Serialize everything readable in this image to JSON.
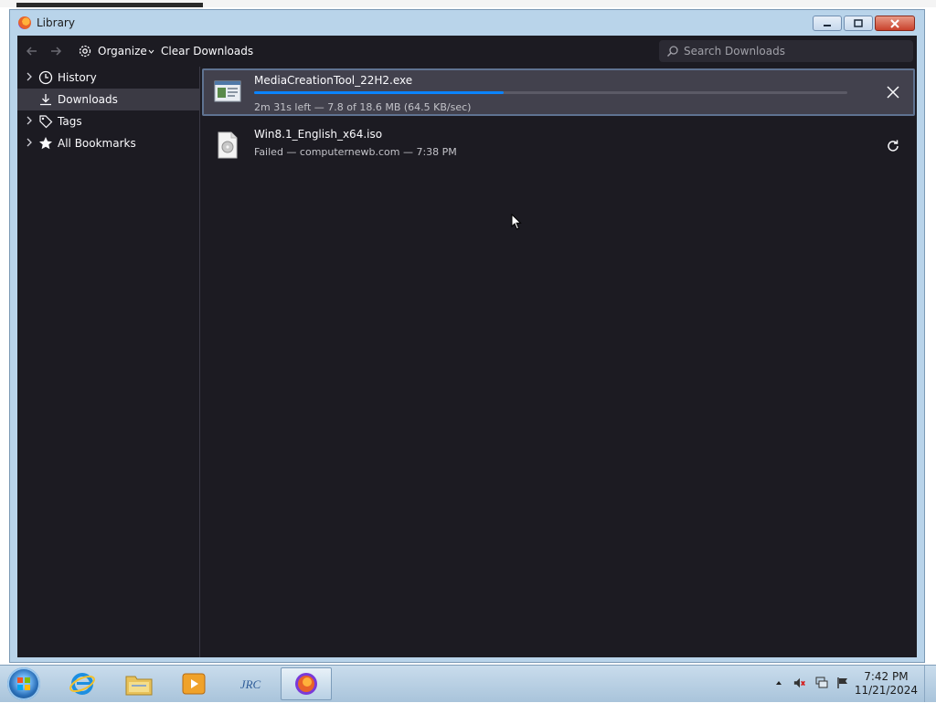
{
  "window": {
    "title": "Library",
    "buttons": {
      "minimize": "–",
      "maximize": "▭",
      "close": "✕"
    }
  },
  "toolbar": {
    "organize_label": "Organize",
    "clear_downloads_label": "Clear Downloads",
    "search_placeholder": "Search Downloads"
  },
  "sidebar": {
    "items": [
      {
        "label": "History",
        "icon": "clock-icon",
        "selected": false
      },
      {
        "label": "Downloads",
        "icon": "download-icon",
        "selected": true
      },
      {
        "label": "Tags",
        "icon": "tag-icon",
        "selected": false
      },
      {
        "label": "All Bookmarks",
        "icon": "star-icon",
        "selected": false
      }
    ]
  },
  "downloads": [
    {
      "filename": "MediaCreationTool_22H2.exe",
      "status": "2m 31s left — 7.8 of 18.6 MB (64.5 KB/sec)",
      "progress": 0.42,
      "action_icon": "cancel-icon"
    },
    {
      "filename": "Win8.1_English_x64.iso",
      "status": "Failed — computernewb.com — 7:38 PM",
      "action_icon": "retry-icon"
    }
  ],
  "taskbar": {
    "clock_time": "7:42 PM",
    "clock_date": "11/21/2024",
    "apps": [
      "internet-explorer-icon",
      "file-explorer-icon",
      "media-player-icon",
      "jrc-icon",
      "firefox-icon"
    ]
  },
  "colors": {
    "accent": "#0a84ff",
    "background": "#1c1b22",
    "selected_row": "#42414d"
  }
}
